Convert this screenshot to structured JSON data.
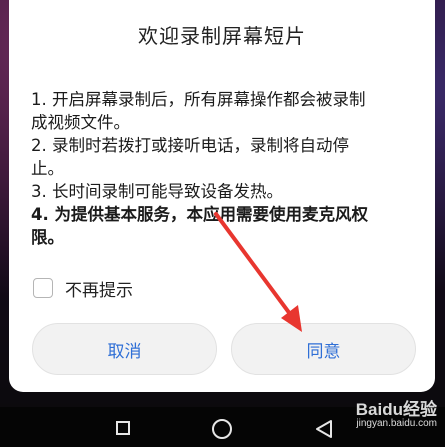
{
  "dialog": {
    "title": "欢迎录制屏幕短片",
    "lines": [
      {
        "text": "1. 开启屏幕录制后，所有屏幕操作都会被录制",
        "bold": false
      },
      {
        "text": "成视频文件。",
        "bold": false
      },
      {
        "text": "2. 录制时若拨打或接听电话，录制将自动停",
        "bold": false
      },
      {
        "text": "止。",
        "bold": false
      },
      {
        "text": "3. 长时间录制可能导致设备发热。",
        "bold": false
      },
      {
        "text": "4. 为提供基本服务，本应用需要使用麦克风权",
        "bold": true
      },
      {
        "text": "限。",
        "bold": true
      }
    ],
    "checkbox": {
      "label": "不再提示",
      "checked": false
    },
    "buttons": {
      "cancel": "取消",
      "agree": "同意"
    }
  },
  "watermark": {
    "main": "Baidu经验",
    "sub": "jingyan.baidu.com"
  },
  "annotation": {
    "arrow_color": "#e8362f"
  },
  "colors": {
    "button_text": "#2f6fd6"
  }
}
